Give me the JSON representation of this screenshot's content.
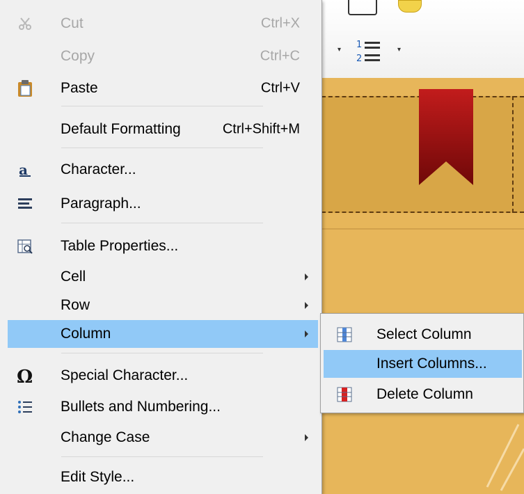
{
  "context_menu": {
    "items": [
      {
        "label": "Cut",
        "shortcut": "Ctrl+X",
        "icon": "cut-icon",
        "disabled": true
      },
      {
        "label": "Copy",
        "shortcut": "Ctrl+C",
        "icon": "copy-icon",
        "disabled": true
      },
      {
        "label": "Paste",
        "shortcut": "Ctrl+V",
        "icon": "paste-icon",
        "disabled": false
      },
      {
        "label": "Default Formatting",
        "shortcut": "Ctrl+Shift+M",
        "disabled": false
      },
      {
        "label": "Character...",
        "icon": "character-icon"
      },
      {
        "label": "Paragraph...",
        "icon": "paragraph-icon"
      },
      {
        "label": "Table Properties...",
        "icon": "table-properties-icon"
      },
      {
        "label": "Cell",
        "submenu": true
      },
      {
        "label": "Row",
        "submenu": true
      },
      {
        "label": "Column",
        "submenu": true,
        "highlighted": true
      },
      {
        "label": "Special Character...",
        "icon": "omega-icon"
      },
      {
        "label": "Bullets and Numbering...",
        "icon": "bullets-icon"
      },
      {
        "label": "Change Case",
        "submenu": true
      },
      {
        "label": "Edit Style..."
      }
    ]
  },
  "column_submenu": {
    "items": [
      {
        "label": "Select Column",
        "icon": "select-column-icon"
      },
      {
        "label": "Insert Columns...",
        "highlighted": true
      },
      {
        "label": "Delete Column",
        "icon": "delete-column-icon"
      }
    ]
  },
  "colors": {
    "menu_background": "#f0f0f0",
    "highlight": "#91c9f7",
    "disabled_text": "#a7a7a7",
    "document_background": "#e7b65a",
    "bookmark_red": "#b01818"
  },
  "toolbar": {
    "numbered_list_icon": "numbered-list-icon"
  }
}
